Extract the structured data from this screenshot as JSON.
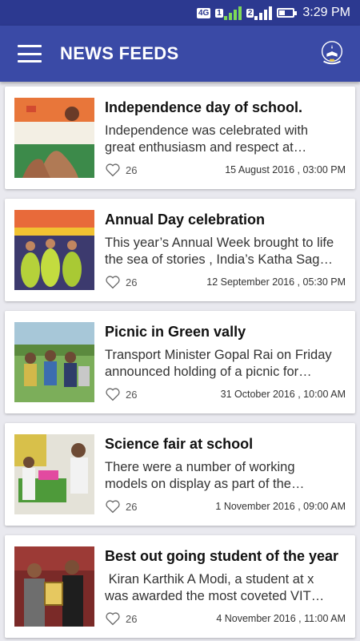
{
  "status_bar": {
    "network": "4G",
    "sim1": "1",
    "sim2": "2",
    "battery_level": 0.45,
    "time": "3:29 PM"
  },
  "app_bar": {
    "title": "NEWS FEEDS"
  },
  "feed": [
    {
      "title": "Independence day of school.",
      "desc_1": "Independence was celebrated with",
      "desc_2": "great enthusiasm and respect at…",
      "likes": "26",
      "date": "15 August 2016 , 03:00 PM"
    },
    {
      "title": "Annual Day celebration",
      "desc_1": "This year’s Annual Week brought to life",
      "desc_2": "the sea of stories , India’s Katha Sag…",
      "likes": "26",
      "date": "12 September 2016 , 05:30 PM"
    },
    {
      "title": "Picnic in Green vally",
      "desc_1": "Transport Minister Gopal Rai on Friday",
      "desc_2": "announced holding of a picnic for…",
      "likes": "26",
      "date": "31 October 2016 , 10:00 AM"
    },
    {
      "title": "Science fair at school",
      "desc_1": "There were a number of working",
      "desc_2": "models on display as part of the…",
      "likes": "26",
      "date": "1 November 2016 , 09:00 AM"
    },
    {
      "title": "Best out going student of the year",
      "desc_1": " Kiran Karthik A Modi, a student at x",
      "desc_2": "was awarded the most coveted VIT…",
      "likes": "26",
      "date": "4 November 2016 , 11:00 AM"
    }
  ],
  "colors": {
    "status_bar": "#2c3990",
    "app_bar": "#3a4aa6",
    "background": "#e9e9ef",
    "card": "#ffffff"
  }
}
